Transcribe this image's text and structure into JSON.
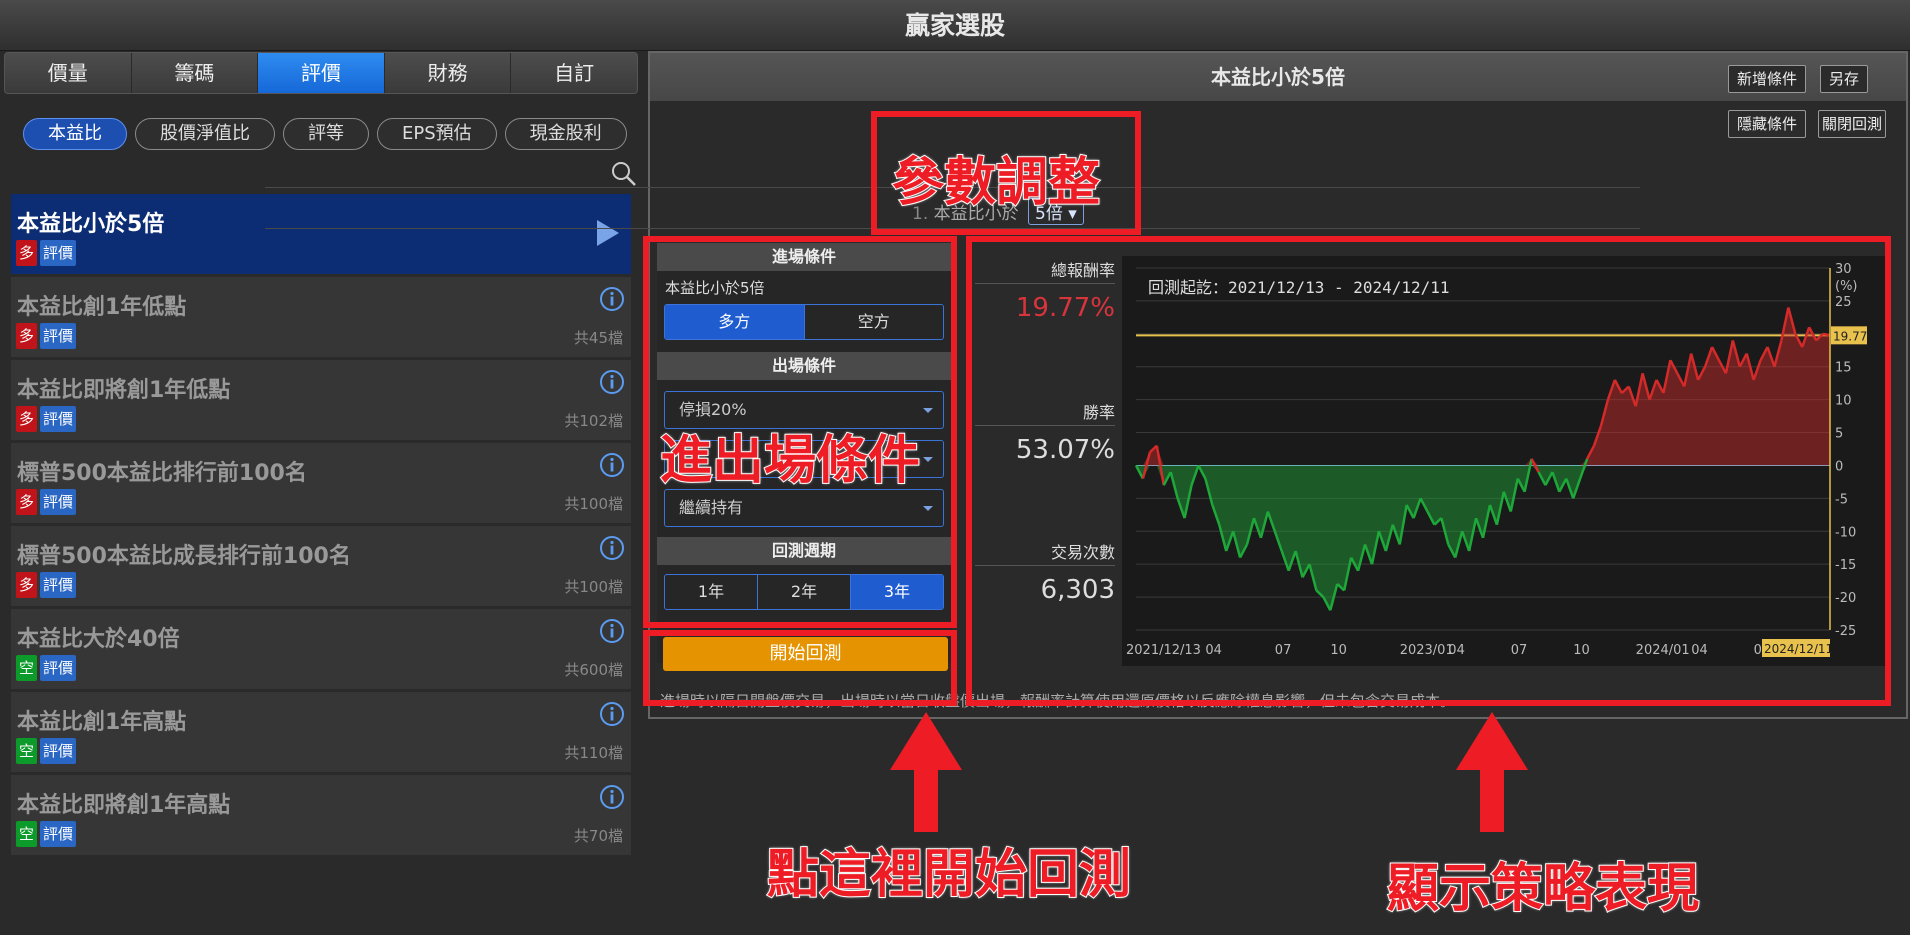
{
  "app": {
    "title": "贏家選股"
  },
  "tabs": [
    {
      "label": "價量",
      "active": false
    },
    {
      "label": "籌碼",
      "active": false
    },
    {
      "label": "評價",
      "active": true
    },
    {
      "label": "財務",
      "active": false
    },
    {
      "label": "自訂",
      "active": false
    }
  ],
  "chips": [
    {
      "label": "本益比",
      "active": true
    },
    {
      "label": "股價淨值比",
      "active": false
    },
    {
      "label": "評等",
      "active": false
    },
    {
      "label": "EPS預估",
      "active": false
    },
    {
      "label": "現金股利",
      "active": false
    }
  ],
  "search": {
    "icon": "search-icon"
  },
  "strategies": [
    {
      "title": "本益比小於5倍",
      "side": "多",
      "cat": "評價",
      "count": "",
      "selected": true
    },
    {
      "title": "本益比創1年低點",
      "side": "多",
      "cat": "評價",
      "count": "共45檔"
    },
    {
      "title": "本益比即將創1年低點",
      "side": "多",
      "cat": "評價",
      "count": "共102檔"
    },
    {
      "title": "標普500本益比排行前100名",
      "side": "多",
      "cat": "評價",
      "count": "共100檔"
    },
    {
      "title": "標普500本益比成長排行前100名",
      "side": "多",
      "cat": "評價",
      "count": "共100檔"
    },
    {
      "title": "本益比大於40倍",
      "side": "空",
      "cat": "評價",
      "count": "共600檔"
    },
    {
      "title": "本益比創1年高點",
      "side": "空",
      "cat": "評價",
      "count": "共110檔"
    },
    {
      "title": "本益比即將創1年高點",
      "side": "空",
      "cat": "評價",
      "count": "共70檔"
    }
  ],
  "detail": {
    "title": "本益比小於5倍",
    "buttons": {
      "add": "新增條件",
      "save_as": "另存",
      "hide": "隱藏條件",
      "close_bt": "關閉回測"
    },
    "param": {
      "index": "1.",
      "label": "本益比小於",
      "value": "5倍"
    }
  },
  "conditions": {
    "entry_head": "進場條件",
    "entry_label": "本益比小於5倍",
    "sides": [
      "多方",
      "空方"
    ],
    "active_side": "多方",
    "exit_head": "出場條件",
    "exit_options": [
      "停損20%",
      "",
      "繼續持有"
    ],
    "period_head": "回測週期",
    "periods": [
      "1年",
      "2年",
      "3年"
    ],
    "active_period": "3年",
    "start_label": "開始回測"
  },
  "stats": {
    "return_label": "總報酬率",
    "return_value": "19.77%",
    "winrate_label": "勝率",
    "winrate_value": "53.07%",
    "trades_label": "交易次數",
    "trades_value": "6,303"
  },
  "chart_data": {
    "type": "area",
    "title": "回測起訖：2021/12/13 - 2024/12/11",
    "unit": "(%)",
    "ylim": [
      -25,
      30
    ],
    "yticks": [
      30,
      25,
      20,
      15,
      10,
      5,
      0,
      -5,
      -10,
      -15,
      -20,
      -25
    ],
    "xticks": [
      "2021/12/13",
      "04",
      "07",
      "10",
      "2023/01",
      "04",
      "07",
      "10",
      "2024/01",
      "04",
      "07",
      "2024/12/11"
    ],
    "xtick_pos": [
      0,
      0.1,
      0.2,
      0.28,
      0.38,
      0.45,
      0.54,
      0.63,
      0.72,
      0.8,
      0.89,
      1
    ],
    "final_value": 19.77,
    "final_label": "19.77",
    "x_end_label": "2024/12/11",
    "points": [
      [
        0,
        0
      ],
      [
        0.01,
        -2
      ],
      [
        0.02,
        2
      ],
      [
        0.03,
        3
      ],
      [
        0.04,
        -3
      ],
      [
        0.05,
        -1
      ],
      [
        0.06,
        -5
      ],
      [
        0.07,
        -8
      ],
      [
        0.08,
        -3
      ],
      [
        0.09,
        0
      ],
      [
        0.1,
        -2
      ],
      [
        0.11,
        -6
      ],
      [
        0.12,
        -9
      ],
      [
        0.13,
        -13
      ],
      [
        0.14,
        -10
      ],
      [
        0.15,
        -14
      ],
      [
        0.16,
        -12
      ],
      [
        0.17,
        -8
      ],
      [
        0.18,
        -11
      ],
      [
        0.19,
        -7
      ],
      [
        0.2,
        -10
      ],
      [
        0.21,
        -13
      ],
      [
        0.22,
        -16
      ],
      [
        0.23,
        -13
      ],
      [
        0.24,
        -17
      ],
      [
        0.25,
        -15
      ],
      [
        0.26,
        -19
      ],
      [
        0.27,
        -20
      ],
      [
        0.28,
        -22
      ],
      [
        0.29,
        -18
      ],
      [
        0.3,
        -19
      ],
      [
        0.31,
        -14
      ],
      [
        0.32,
        -16
      ],
      [
        0.33,
        -12
      ],
      [
        0.34,
        -15
      ],
      [
        0.35,
        -10
      ],
      [
        0.36,
        -13
      ],
      [
        0.37,
        -9
      ],
      [
        0.38,
        -12
      ],
      [
        0.39,
        -6
      ],
      [
        0.4,
        -8
      ],
      [
        0.41,
        -5
      ],
      [
        0.42,
        -7
      ],
      [
        0.43,
        -9
      ],
      [
        0.44,
        -8
      ],
      [
        0.45,
        -12
      ],
      [
        0.46,
        -14
      ],
      [
        0.47,
        -10
      ],
      [
        0.48,
        -13
      ],
      [
        0.49,
        -8
      ],
      [
        0.5,
        -11
      ],
      [
        0.51,
        -6
      ],
      [
        0.52,
        -9
      ],
      [
        0.53,
        -4
      ],
      [
        0.54,
        -7
      ],
      [
        0.55,
        -2
      ],
      [
        0.56,
        -4
      ],
      [
        0.57,
        1
      ],
      [
        0.58,
        -1
      ],
      [
        0.59,
        -3
      ],
      [
        0.6,
        -1
      ],
      [
        0.61,
        -4
      ],
      [
        0.62,
        -2
      ],
      [
        0.63,
        -5
      ],
      [
        0.64,
        -2
      ],
      [
        0.65,
        1
      ],
      [
        0.66,
        3
      ],
      [
        0.67,
        6
      ],
      [
        0.68,
        10
      ],
      [
        0.69,
        13
      ],
      [
        0.7,
        11
      ],
      [
        0.71,
        12
      ],
      [
        0.72,
        9
      ],
      [
        0.73,
        14
      ],
      [
        0.74,
        10
      ],
      [
        0.75,
        13
      ],
      [
        0.76,
        11
      ],
      [
        0.77,
        16
      ],
      [
        0.78,
        14
      ],
      [
        0.79,
        12
      ],
      [
        0.8,
        17
      ],
      [
        0.81,
        13
      ],
      [
        0.82,
        15
      ],
      [
        0.83,
        18
      ],
      [
        0.84,
        16
      ],
      [
        0.85,
        14
      ],
      [
        0.86,
        19
      ],
      [
        0.87,
        15
      ],
      [
        0.88,
        17
      ],
      [
        0.89,
        13
      ],
      [
        0.9,
        16
      ],
      [
        0.91,
        18
      ],
      [
        0.92,
        15
      ],
      [
        0.93,
        19
      ],
      [
        0.94,
        24
      ],
      [
        0.95,
        20
      ],
      [
        0.96,
        18
      ],
      [
        0.97,
        21
      ],
      [
        0.98,
        19
      ],
      [
        0.99,
        20
      ],
      [
        1,
        19.77
      ]
    ],
    "colors": {
      "positive": "#d42a2a",
      "negative": "#1fa83a",
      "ref": "#e8c24c"
    }
  },
  "disclaimer": "進場時以隔日開盤價交易，出場時以當日收盤價出場，報酬率計算使用還原價格以反應除權息影響，但未包含交易成本。",
  "annotations": {
    "param_adjust": "參數調整",
    "entry_exit": "進出場條件",
    "click_start": "點這裡開始回測",
    "show_perf": "顯示策略表現"
  }
}
